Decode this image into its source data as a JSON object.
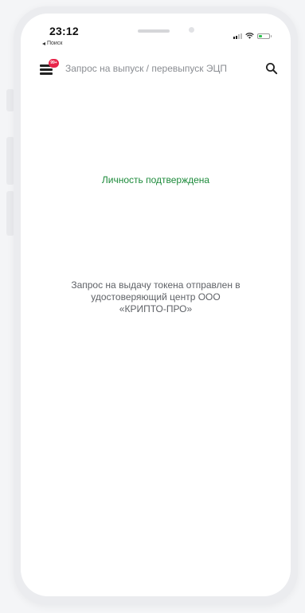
{
  "status_bar": {
    "time": "23:12",
    "back_label": "Поиск"
  },
  "header": {
    "menu_icon": "hamburger-menu-icon",
    "badge_text": "99+",
    "title": "Запрос на выпуск / перевыпуск ЭЦП",
    "search_icon": "search-icon"
  },
  "content": {
    "status_text": "Личность подтверждена",
    "message": "Запрос на выдачу токена отправлен в удостоверяющий центр ООО «КРИПТО-ПРО»"
  },
  "colors": {
    "status_green": "#1c8a3a",
    "badge_red": "#e8264b",
    "message_gray": "#5f6267",
    "title_gray": "#8a8d92"
  }
}
